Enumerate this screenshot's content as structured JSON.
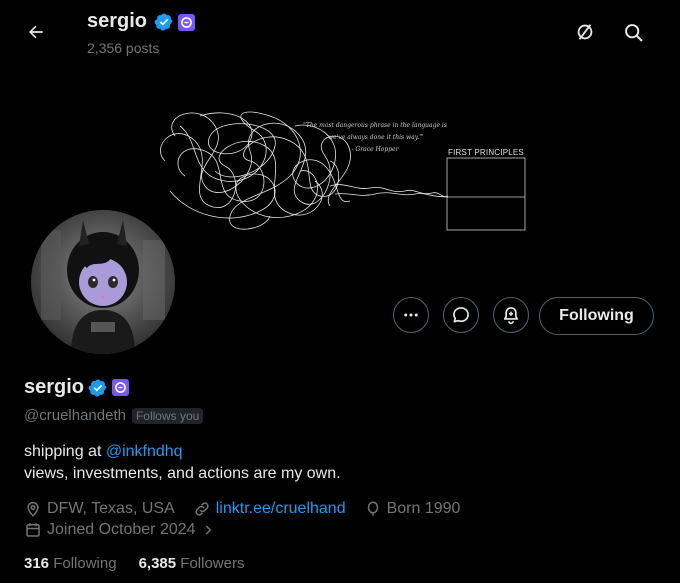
{
  "header": {
    "name": "sergio",
    "posts": "2,356 posts"
  },
  "banner": {
    "quote_line1": "\"The most dangerous phrase in the language is",
    "quote_line2": "'we've always done it this way.'\"",
    "quote_line3": "- Grace Hopper",
    "label": "FIRST PRINCIPLES"
  },
  "actions": {
    "following_label": "Following"
  },
  "profile": {
    "name": "sergio",
    "handle": "@cruelhandeth",
    "follows_you": "Follows you",
    "bio_prefix": "shipping at ",
    "bio_mention": "@inkfndhq",
    "bio_line2": "views, investments, and actions are my own.",
    "location": "DFW, Texas, USA",
    "website": "linktr.ee/cruelhand",
    "born": "Born 1990",
    "joined": "Joined October 2024"
  },
  "stats": {
    "following_count": "316",
    "following_label": "Following",
    "followers_count": "6,385",
    "followers_label": "Followers"
  },
  "colors": {
    "accent": "#1d9bf0",
    "verified": "#1d9bf0",
    "org_badge": "#7856ff",
    "muted": "#71767b"
  }
}
